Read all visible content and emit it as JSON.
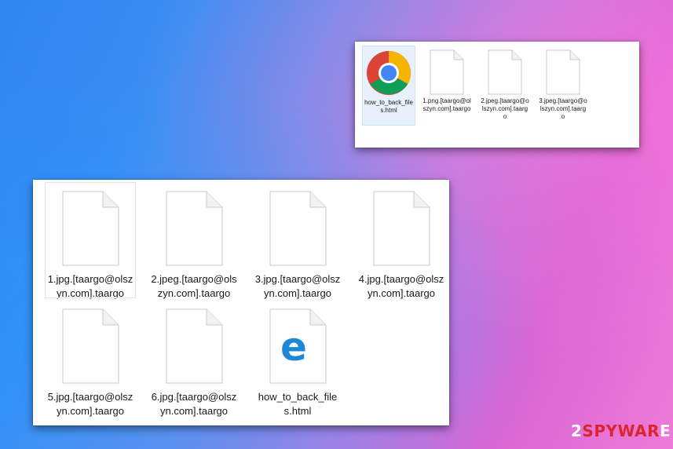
{
  "top_window": {
    "files": [
      {
        "name": "how_to_back_files.html",
        "icon": "chrome-icon",
        "selected": true
      },
      {
        "name": "1.png.[taargo@olszyn.com].taargo",
        "icon": "blank-file-icon"
      },
      {
        "name": "2.jpeg.[taargo@olszyn.com].taargo",
        "icon": "blank-file-icon"
      },
      {
        "name": "3.jpeg.[taargo@olszyn.com].taargo",
        "icon": "blank-file-icon"
      }
    ]
  },
  "bottom_window": {
    "files": [
      {
        "name": "1.jpg.[taargo@olszyn.com].taargo",
        "icon": "blank-file-icon",
        "hover": true
      },
      {
        "name": "2.jpeg.[taargo@olszyn.com].taargo",
        "icon": "blank-file-icon"
      },
      {
        "name": "3.jpg.[taargo@olszyn.com].taargo",
        "icon": "blank-file-icon"
      },
      {
        "name": "4.jpg.[taargo@olszyn.com].taargo",
        "icon": "blank-file-icon"
      },
      {
        "name": "5.jpg.[taargo@olszyn.com].taargo",
        "icon": "blank-file-icon"
      },
      {
        "name": "6.jpg.[taargo@olszyn.com].taargo",
        "icon": "blank-file-icon"
      },
      {
        "name": "how_to_back_files.html",
        "icon": "edge-html-file-icon"
      }
    ]
  },
  "watermark": {
    "prefix": "2",
    "accent": "SPYWAR",
    "suffix": "E"
  },
  "colors": {
    "watermark_accent": "#d9252b",
    "edge_blue": "#1e88d6",
    "file_border": "#c9c9c9"
  }
}
